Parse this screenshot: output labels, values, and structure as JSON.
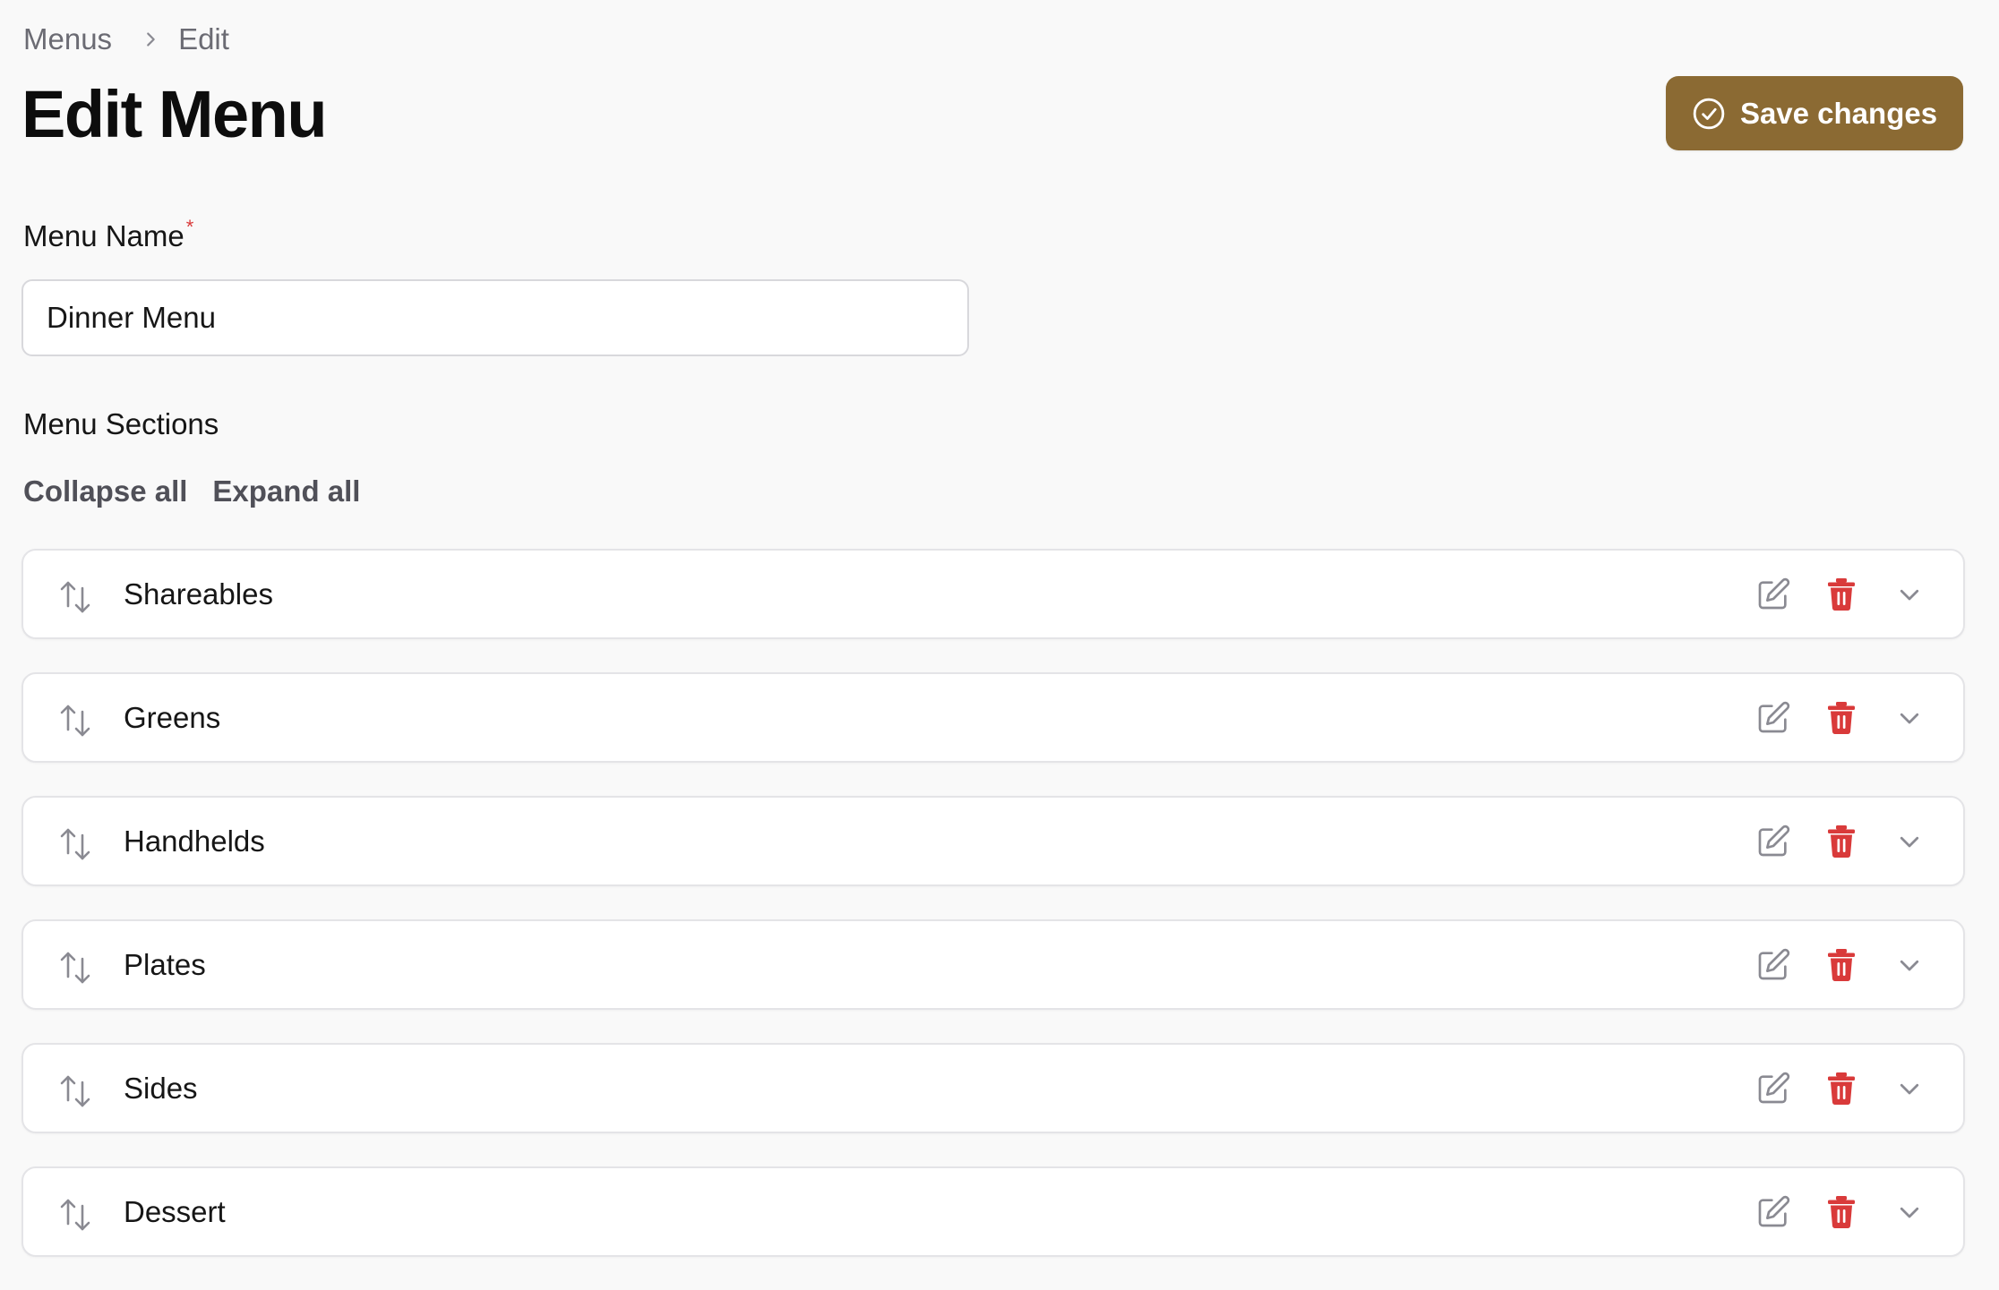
{
  "breadcrumb": {
    "items": [
      "Menus",
      "Edit"
    ]
  },
  "page": {
    "title": "Edit Menu"
  },
  "actions": {
    "save_label": "Save changes"
  },
  "menu_name": {
    "label": "Menu Name",
    "required_mark": "*",
    "value": "Dinner Menu"
  },
  "sections": {
    "label": "Menu Sections",
    "collapse_label": "Collapse all",
    "expand_label": "Expand all",
    "items": [
      {
        "name": "Shareables"
      },
      {
        "name": "Greens"
      },
      {
        "name": "Handhelds"
      },
      {
        "name": "Plates"
      },
      {
        "name": "Sides"
      },
      {
        "name": "Dessert"
      }
    ]
  },
  "icons": {
    "breadcrumb_separator": "chevron-right-icon",
    "save": "check-circle-icon",
    "drag": "sort-arrows-icon",
    "edit": "pencil-square-icon",
    "delete": "trash-icon",
    "expand": "chevron-down-icon"
  },
  "colors": {
    "accent": "#8b6a33",
    "danger": "#d93a3a",
    "muted_icon": "#8a8a92",
    "background": "#f9f9f9"
  }
}
